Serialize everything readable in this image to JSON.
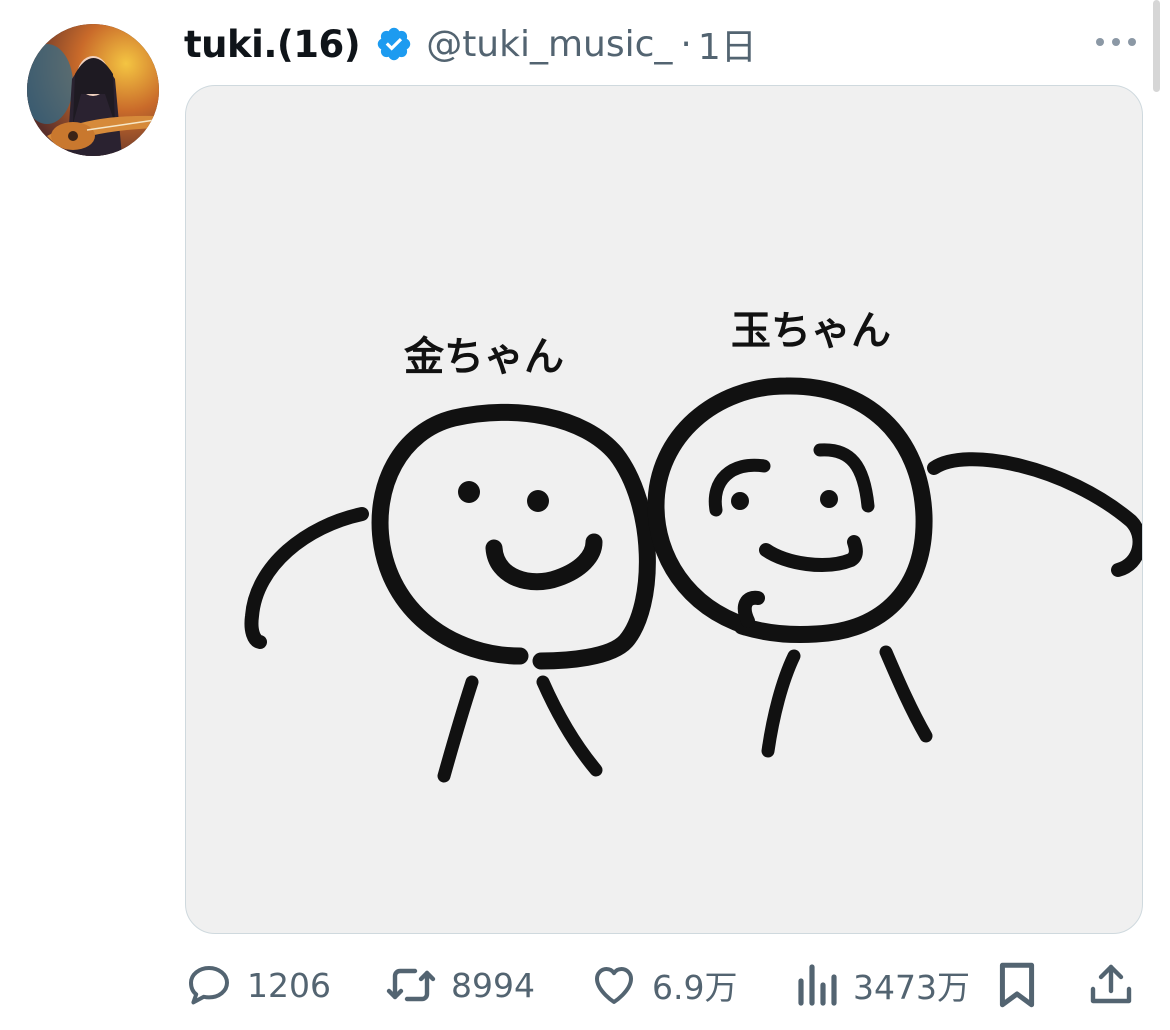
{
  "author": {
    "display_name": "tuki.(16)",
    "handle": "@tuki_music_",
    "separator": "·",
    "time": "1日"
  },
  "media": {
    "label_left": "金ちゃん",
    "label_right": "玉ちゃん"
  },
  "actions": {
    "replies": "1206",
    "retweets": "8994",
    "likes": "6.9万",
    "views": "3473万"
  },
  "icons": {
    "verified": "verified-badge-icon",
    "more": "more-dots-icon",
    "reply": "reply-bubble-icon",
    "retweet": "retweet-icon",
    "like": "heart-icon",
    "views": "bar-chart-icon",
    "bookmark": "bookmark-icon",
    "share": "share-upload-icon"
  },
  "colors": {
    "verified": "#1d9bf0",
    "secondary_text": "#536471",
    "media_bg": "#f0f0f0"
  }
}
